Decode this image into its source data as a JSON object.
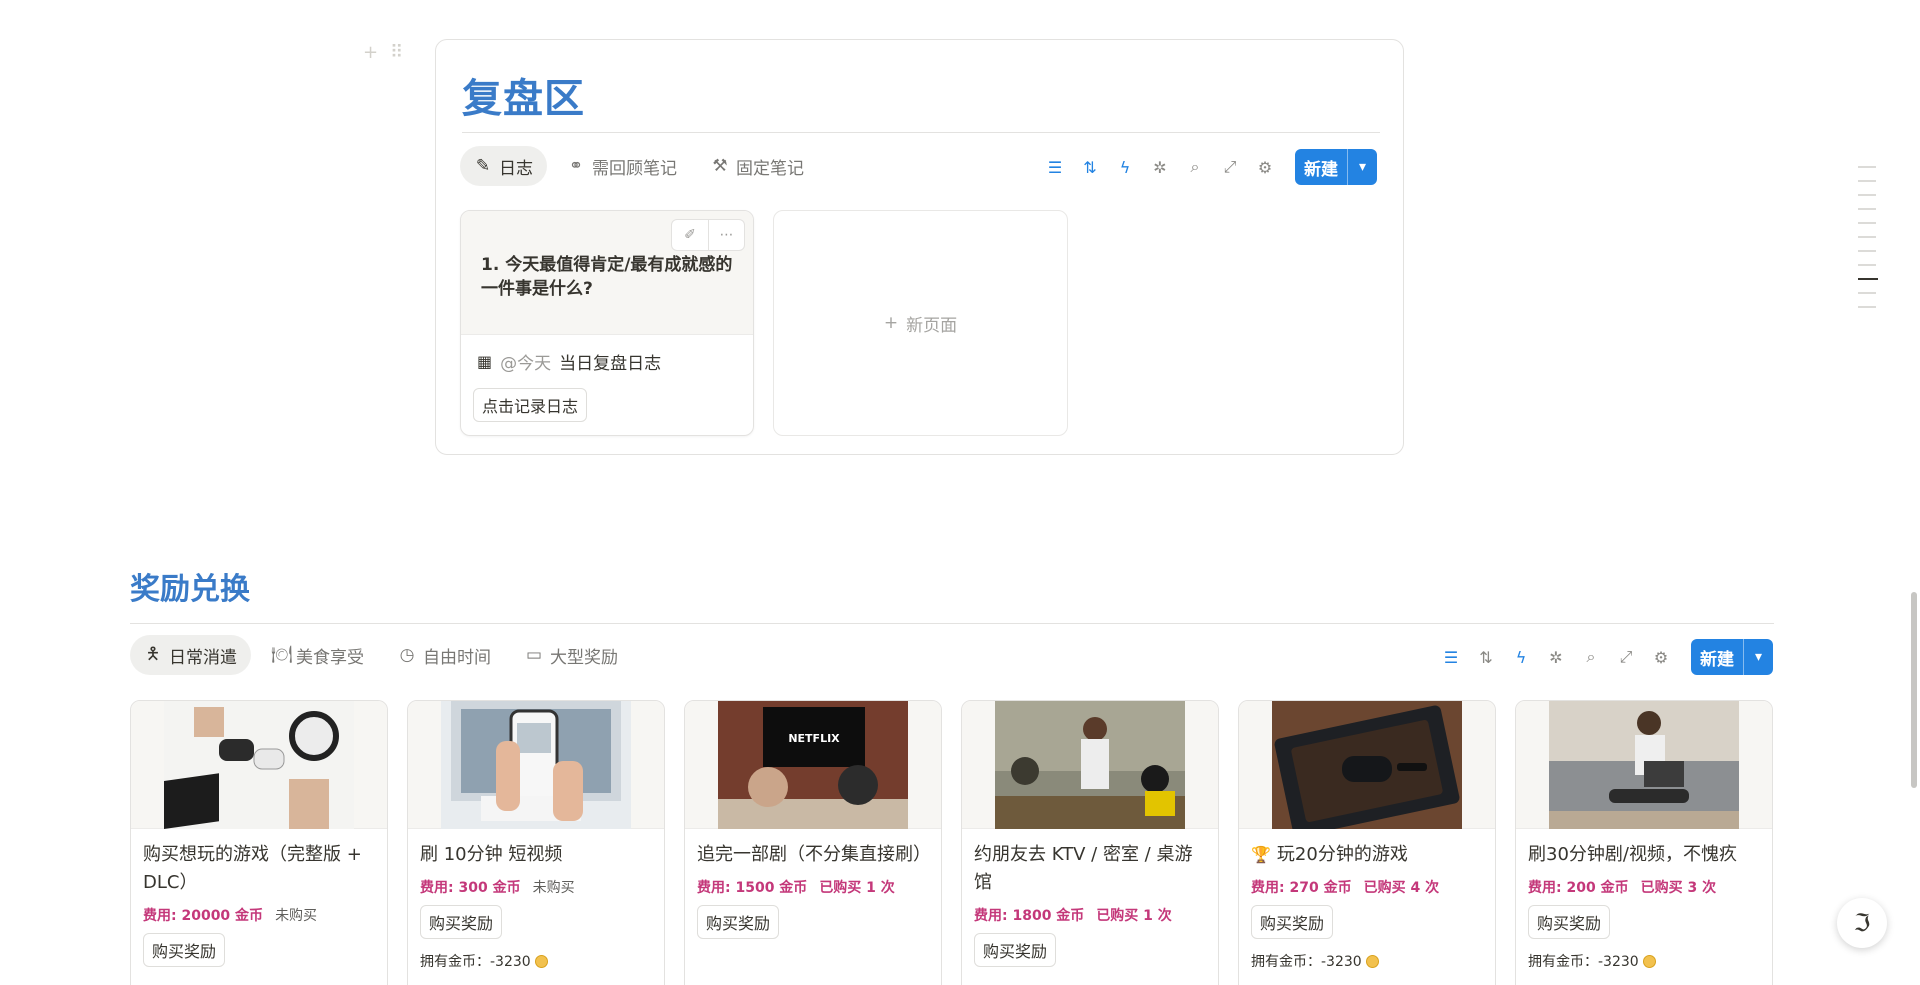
{
  "review": {
    "title": "复盘区",
    "tabs": [
      {
        "label": "日志",
        "icon": "pencil-icon",
        "active": true
      },
      {
        "label": "需回顾笔记",
        "icon": "binoculars-icon",
        "active": false
      },
      {
        "label": "固定笔记",
        "icon": "hammer-icon",
        "active": false
      }
    ],
    "new_label": "新建",
    "journal_card": {
      "question": "1. 今天最值得肯定/最有成就感的一件事是什么?",
      "mention_date": "@今天",
      "mention_text": "当日复盘日志",
      "button": "点击记录日志"
    },
    "new_page_label": "新页面"
  },
  "rewards": {
    "title": "奖励兑换",
    "tabs": [
      {
        "label": "日常消遣",
        "icon": "person-icon",
        "active": true
      },
      {
        "label": "美食享受",
        "icon": "utensils-icon",
        "active": false
      },
      {
        "label": "自由时间",
        "icon": "clock-icon",
        "active": false
      },
      {
        "label": "大型奖励",
        "icon": "card-icon",
        "active": false
      }
    ],
    "new_label": "新建",
    "cards": [
      {
        "title": "购买想玩的游戏（完整版 + DLC）",
        "cost": "费用: 20000 金币",
        "bought": "未购买",
        "bought_none": true,
        "button": "购买奖励",
        "coins": "",
        "photo": "controllers"
      },
      {
        "title": "刷 10分钟 短视频",
        "cost": "费用: 300 金币",
        "bought": "未购买",
        "bought_none": true,
        "button": "购买奖励",
        "coins": "拥有金币：-3230",
        "photo": "phone"
      },
      {
        "title": "追完一部剧（不分集直接刷）",
        "cost": "费用: 1500 金币",
        "bought": "已购买 1 次",
        "bought_none": false,
        "button": "购买奖励",
        "coins": "",
        "photo": "netflix"
      },
      {
        "title": "约朋友去 KTV / 密室 / 桌游馆",
        "cost": "费用: 1800 金币",
        "bought": "已购买 1 次",
        "bought_none": false,
        "button": "购买奖励",
        "coins": "",
        "photo": "friends"
      },
      {
        "title": "玩20分钟的游戏",
        "cost": "费用: 270 金币",
        "bought": "已购买 4 次",
        "bought_none": false,
        "button": "购买奖励",
        "coins": "拥有金币：-3230",
        "photo": "gamepad",
        "trophy": true
      },
      {
        "title": "刷30分钟剧/视频，不愧疚",
        "cost": "费用: 200 金币",
        "bought": "已购买 3 次",
        "bought_none": false,
        "button": "购买奖励",
        "coins": "拥有金币：-3230",
        "photo": "laptop"
      }
    ]
  },
  "photo_text": {
    "netflix": "NETFLIX"
  },
  "colors": {
    "heading": "#3a7bc8",
    "accent": "#2383e2",
    "cost": "#c4387a"
  }
}
